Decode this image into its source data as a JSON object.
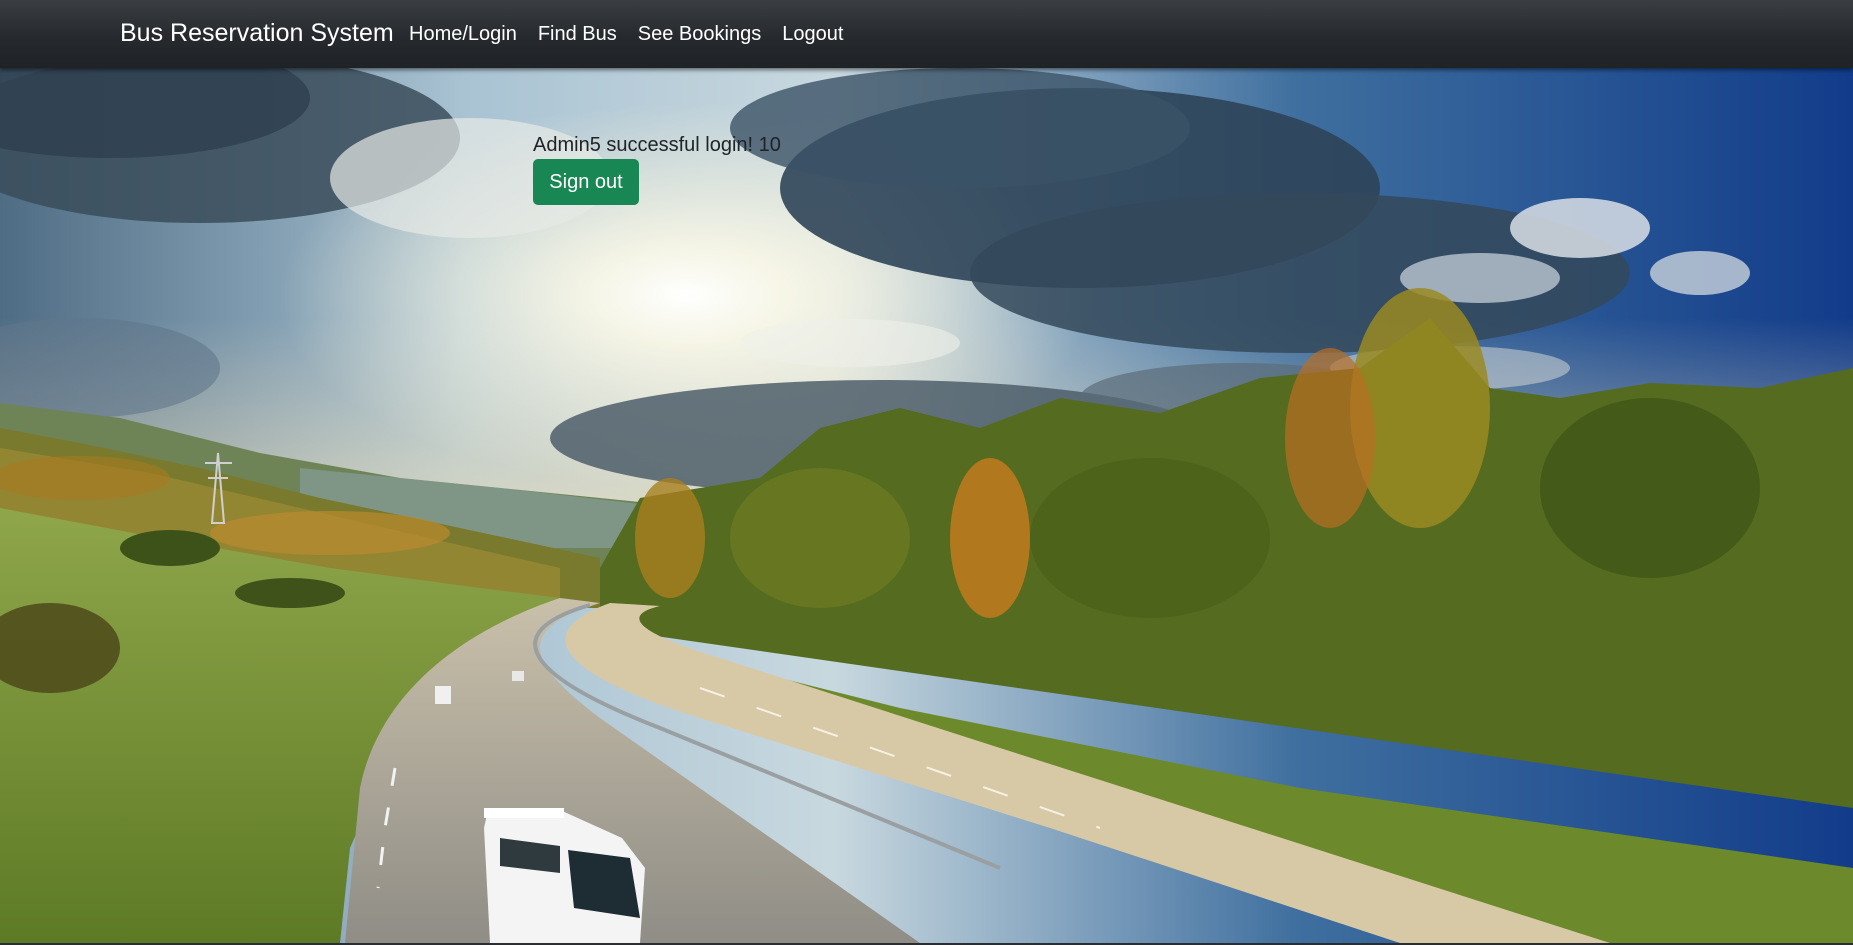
{
  "navbar": {
    "brand": "Bus Reservation System",
    "links": [
      {
        "label": "Home/Login"
      },
      {
        "label": "Find Bus"
      },
      {
        "label": "See Bookings"
      },
      {
        "label": "Logout"
      }
    ]
  },
  "main": {
    "login_message": "Admin5 successful login! 10",
    "signout_label": "Sign out",
    "signout_color": "#198754"
  },
  "hero": {
    "image": "highway-landscape-with-bus-under-cloudy-sunny-sky"
  }
}
